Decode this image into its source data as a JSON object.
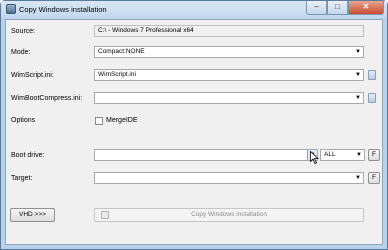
{
  "window": {
    "title": "Copy Windows installation",
    "buttons": {
      "minimize": "–",
      "maximize": "□",
      "close": "✕"
    }
  },
  "source": {
    "label": "Source:",
    "value": "C:\\ - Windows 7 Professional x64"
  },
  "mode": {
    "label": "Mode:",
    "value": "Compact:NONE"
  },
  "wimscript": {
    "label": "WimScript.ini:",
    "value": "WimScript.ini"
  },
  "wimbootcompress": {
    "label": "WimBootCompress.ini:",
    "value": ""
  },
  "options": {
    "label": "Options",
    "mergeide": {
      "label": "MergeIDE",
      "checked": false
    }
  },
  "bootdrive": {
    "label": "Boot drive:",
    "value": "",
    "filter": "ALL",
    "f_button": "F"
  },
  "target": {
    "label": "Target:",
    "value": "",
    "f_button": "F"
  },
  "footer": {
    "vhd_button": "VHD >>>",
    "copy_button": "Copy Windows installation"
  },
  "icons": {
    "app": "copy-windows-icon",
    "combo_arrow": "▼",
    "ini_file": "ini-file-icon",
    "cursor": "mouse-pointer-icon"
  },
  "colors": {
    "accent": "#5c7a99",
    "close": "#c94a2f",
    "client_bg": "#f0f0f0"
  }
}
